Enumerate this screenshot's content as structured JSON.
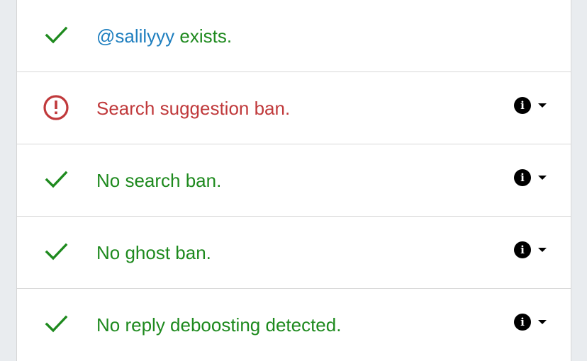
{
  "results": [
    {
      "status": "ok",
      "icon": "check-icon",
      "handle": "@salilyyy",
      "label": " exists.",
      "has_details": false
    },
    {
      "status": "error",
      "icon": "alert-circle-icon",
      "label": "Search suggestion ban.",
      "has_details": true
    },
    {
      "status": "ok",
      "icon": "check-icon",
      "label": "No search ban.",
      "has_details": true
    },
    {
      "status": "ok",
      "icon": "check-icon",
      "label": "No ghost ban.",
      "has_details": true
    },
    {
      "status": "ok",
      "icon": "check-icon",
      "label": "No reply deboosting detected.",
      "has_details": true
    }
  ],
  "icons": {
    "info": "i",
    "details_toggle": "caret-down-icon"
  },
  "colors": {
    "ok": "#1e8a1e",
    "error": "#c0393b",
    "handle_link": "#1f7fbf",
    "background": "#e9ecef"
  }
}
